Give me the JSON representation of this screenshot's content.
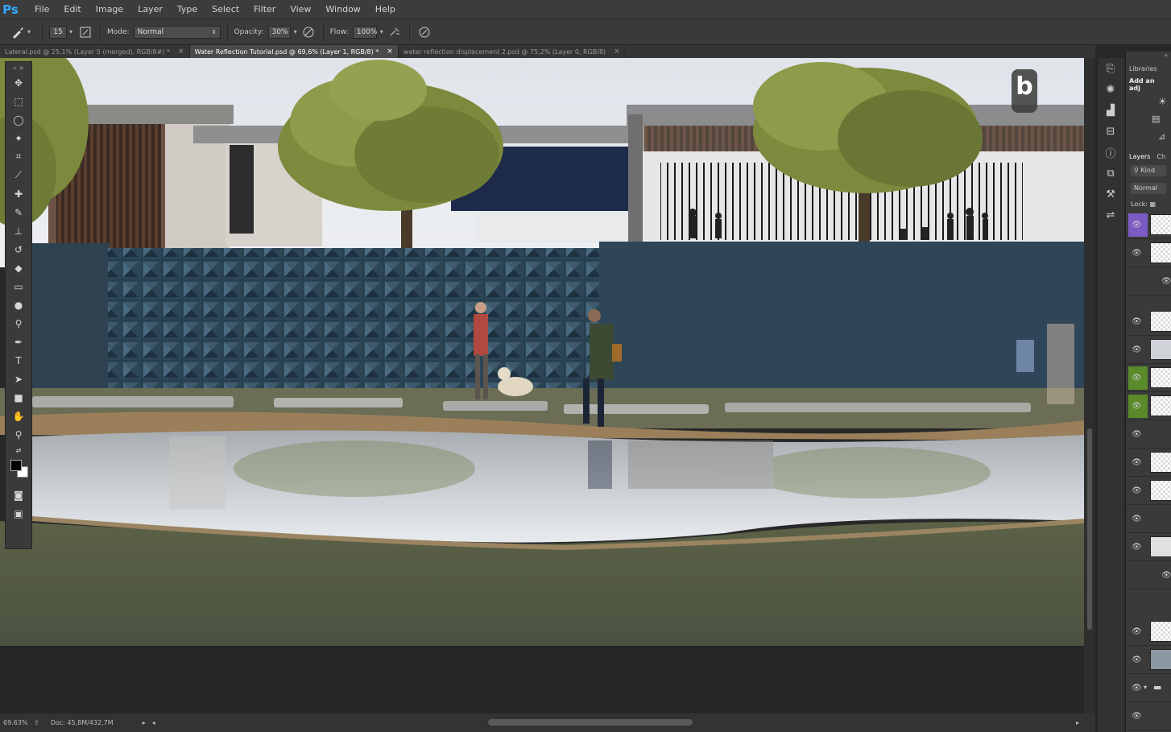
{
  "app": {
    "logo": "Ps"
  },
  "menu": [
    "File",
    "Edit",
    "Image",
    "Layer",
    "Type",
    "Select",
    "Filter",
    "View",
    "Window",
    "Help"
  ],
  "options": {
    "brush_size": "15",
    "mode_label": "Mode:",
    "mode_value": "Normal",
    "opacity_label": "Opacity:",
    "opacity_value": "30%",
    "flow_label": "Flow:",
    "flow_value": "100%"
  },
  "tabs": [
    {
      "label": "Lateral.psd @ 25,1% (Layer 5 (merged), RGB/8#) *",
      "active": false
    },
    {
      "label": "Water Reflection Tutorial.psd @ 69,6% (Layer 1, RGB/8) *",
      "active": true
    },
    {
      "label": "water reflection displacement 2.psd @ 75,2% (Layer 0, RGB/8)",
      "active": false
    }
  ],
  "status": {
    "zoom": "69.63%",
    "doc": "Doc: 45,8M/432,7M"
  },
  "watermark": "b",
  "right_panel": {
    "libraries_tab": "Libraries",
    "adjust_label": "Add an adj",
    "layers_tab": "Layers",
    "channels_tab": "Ch",
    "kind_filter": "Kind",
    "blend_mode": "Normal",
    "lock_label": "Lock:"
  },
  "colors": {
    "accent": "#31a8ff",
    "panel": "#3a3a3a",
    "dark": "#282828"
  }
}
